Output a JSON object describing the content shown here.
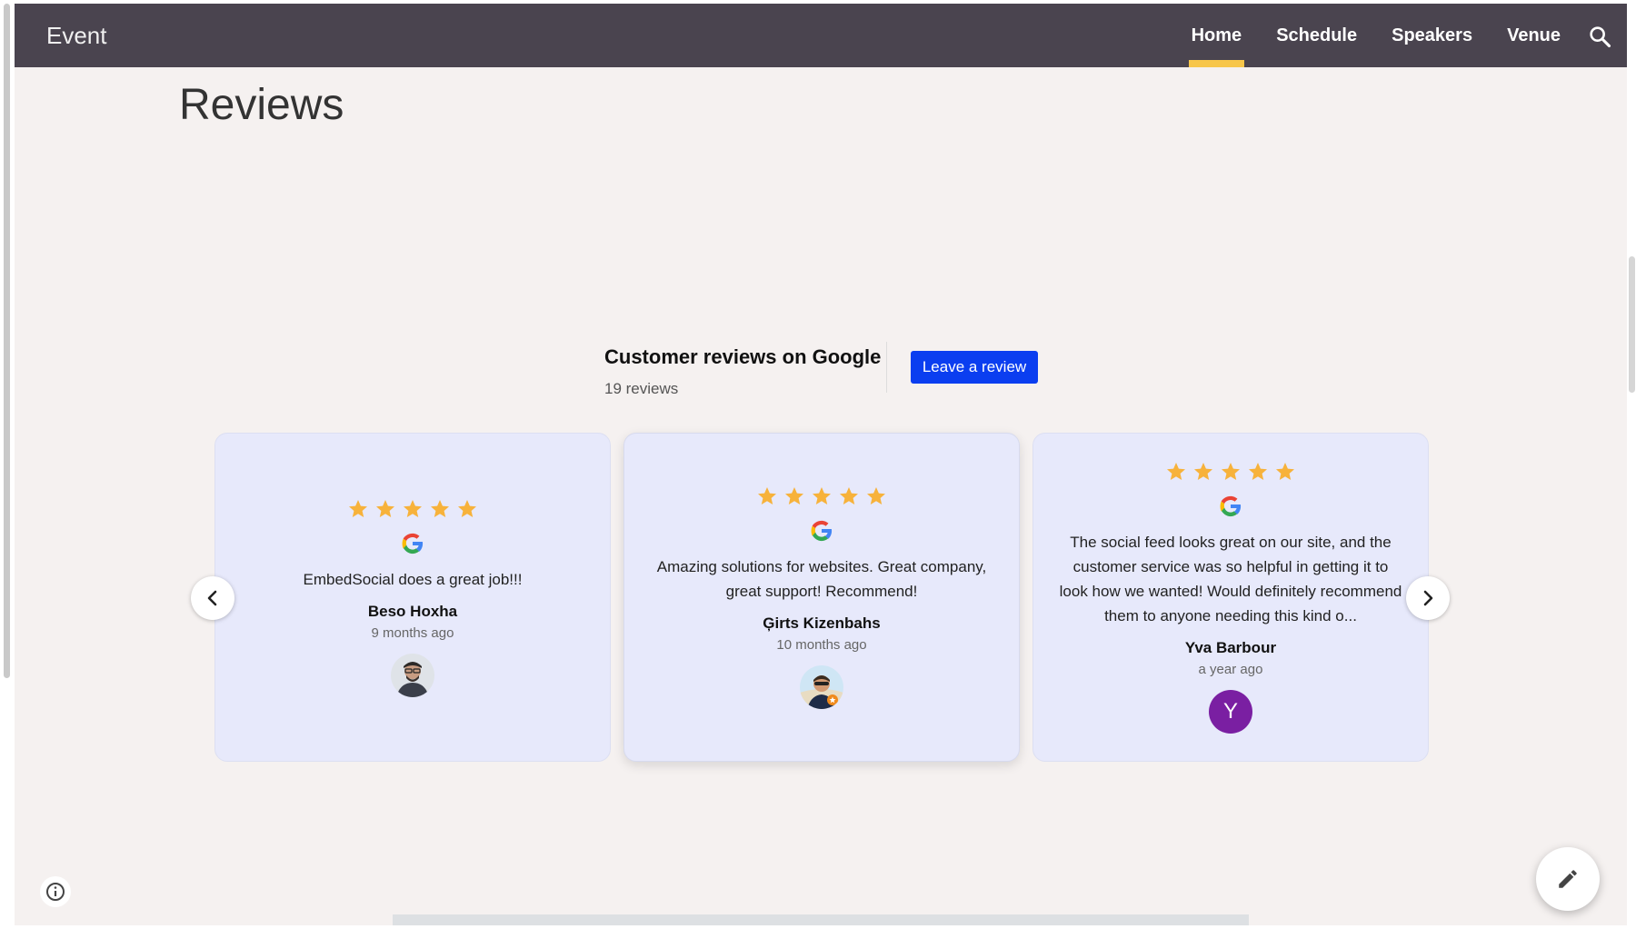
{
  "header": {
    "brand": "Event",
    "nav": [
      {
        "label": "Home",
        "active": true
      },
      {
        "label": "Schedule",
        "active": false
      },
      {
        "label": "Speakers",
        "active": false
      },
      {
        "label": "Venue",
        "active": false
      }
    ],
    "search_icon": "search-icon"
  },
  "page": {
    "title": "Reviews"
  },
  "widget": {
    "title": "Customer reviews on Google",
    "count": "19 reviews",
    "leave_label": "Leave a review",
    "accent": "#0b3ef0"
  },
  "reviews": [
    {
      "rating": 5,
      "text": "EmbedSocial does a great job!!!",
      "name": "Beso Hoxha",
      "ago": "9 months ago",
      "avatar": "photo"
    },
    {
      "rating": 5,
      "text": "Amazing solutions for websites. Great company, great support! Recommend!",
      "name": "Ģirts Kizenbahs",
      "ago": "10 months ago",
      "avatar": "photo"
    },
    {
      "rating": 5,
      "text": "The social feed looks great on our site, and the customer service was so helpful in getting it to look how we wanted! Would definitely recommend them to anyone needing this kind o...",
      "name": "Yva Barbour",
      "ago": "a year ago",
      "avatar_letter": "Y"
    }
  ],
  "colors": {
    "header_bg": "#4a444f",
    "nav_underline": "#f7c64a",
    "star": "#f7b23b",
    "card_bg": "#e7e9fb",
    "avatar_letter_bg": "#7a1fa2"
  },
  "icons": [
    "search-icon",
    "star-icon",
    "google-icon",
    "chevron-left-icon",
    "chevron-right-icon",
    "info-icon",
    "pencil-icon"
  ]
}
